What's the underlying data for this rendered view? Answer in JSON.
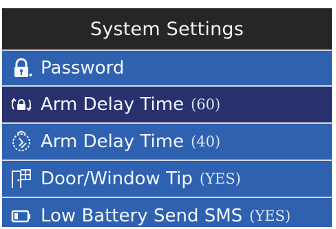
{
  "header": {
    "title": "System Settings"
  },
  "menu": {
    "items": [
      {
        "label": "Password",
        "value": "",
        "icon": "lock-icon"
      },
      {
        "label": "Arm Delay Time",
        "value": "(60)",
        "icon": "arm-delay-icon",
        "selected": true
      },
      {
        "label": "Arm Delay Time",
        "value": "(40)",
        "icon": "timer-icon"
      },
      {
        "label": "Door/Window Tip",
        "value": "(YES)",
        "icon": "door-window-icon"
      },
      {
        "label": "Low Battery Send SMS",
        "value": "(YES)",
        "icon": "battery-icon"
      }
    ]
  },
  "colors": {
    "header_bg": "#262626",
    "row_bg": "#2e61b0",
    "selected_bg": "#28306e",
    "text": "#f4f6fb"
  }
}
